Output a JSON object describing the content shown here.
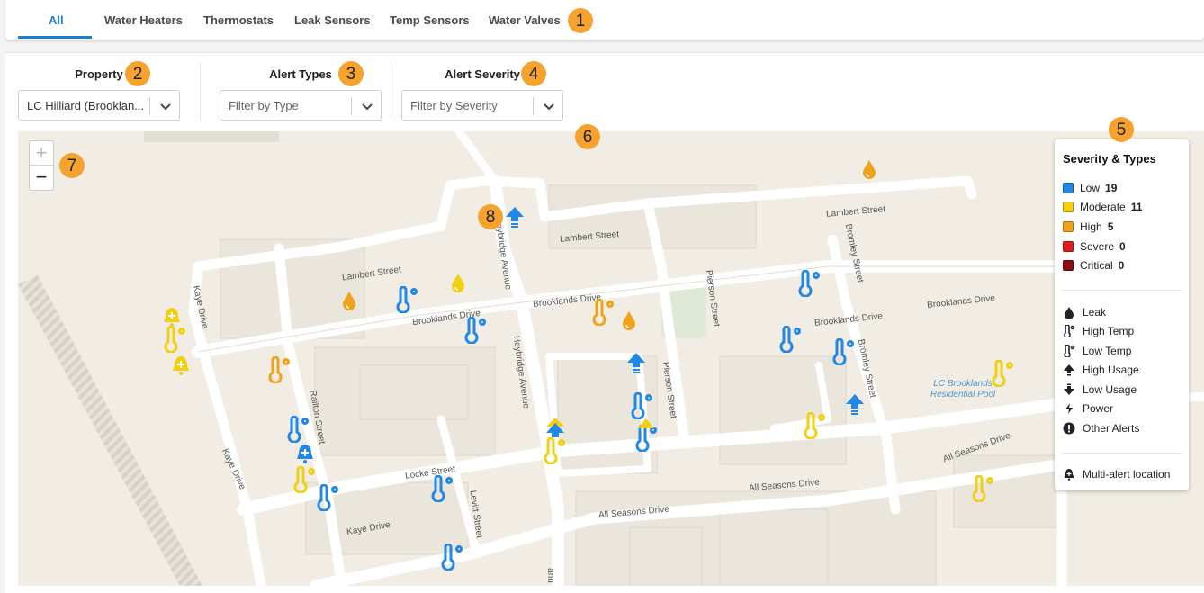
{
  "tabs": [
    {
      "label": "All",
      "active": true
    },
    {
      "label": "Water Heaters"
    },
    {
      "label": "Thermostats"
    },
    {
      "label": "Leak Sensors"
    },
    {
      "label": "Temp Sensors"
    },
    {
      "label": "Water Valves"
    }
  ],
  "filters": {
    "property": {
      "label": "Property",
      "value": "LC Hilliard (Brooklan..."
    },
    "alert_types": {
      "label": "Alert Types",
      "placeholder": "Filter by Type"
    },
    "alert_severity": {
      "label": "Alert Severity",
      "placeholder": "Filter by Severity"
    }
  },
  "badges": [
    "1",
    "2",
    "3",
    "4",
    "5",
    "6",
    "7",
    "8"
  ],
  "zoom": {
    "in": "+",
    "out": "−"
  },
  "map": {
    "streets": {
      "lambert_1": "Lambert Street",
      "lambert_2": "Lambert Street",
      "lambert_3": "Lambert Street",
      "kaye_1": "Kaye Drive",
      "kaye_2": "Kaye Drive",
      "kaye_3": "Kaye Drive",
      "brooklands_1": "Brooklands Drive",
      "brooklands_2": "Brooklands Drive",
      "brooklands_3": "Brooklands Drive",
      "brooklands_4": "Brooklands Drive",
      "heybridge_1": "Heybridge Avenue",
      "heybridge_2": "Heybridge Avenue",
      "heybridge_3": "anu",
      "pierson_1": "Pierson Street",
      "pierson_2": "Pierson Street",
      "bromley_1": "Bromley Street",
      "bromley_2": "Bromley Street",
      "railton": "Railton Street",
      "locke": "Locke Street",
      "levitt": "Levitt Street",
      "allseasons_1": "All Seasons Drive",
      "allseasons_2": "All Seasons Drive",
      "allseasons_3": "All Seasons Drive"
    },
    "pool_label": "LC Brooklands Residential Pool"
  },
  "legend": {
    "title": "Severity & Types",
    "severities": [
      {
        "label": "Low",
        "count": "19",
        "color": "#2188e6"
      },
      {
        "label": "Moderate",
        "count": "11",
        "color": "#f1d012"
      },
      {
        "label": "High",
        "count": "5",
        "color": "#f0a21a"
      },
      {
        "label": "Severe",
        "count": "0",
        "color": "#e21d1d"
      },
      {
        "label": "Critical",
        "count": "0",
        "color": "#8b1010"
      }
    ],
    "types": [
      {
        "label": "Leak",
        "icon": "droplet-icon"
      },
      {
        "label": "High Temp",
        "icon": "thermometer-icon"
      },
      {
        "label": "Low Temp",
        "icon": "thermometer-icon"
      },
      {
        "label": "High Usage",
        "icon": "arrow-up-icon"
      },
      {
        "label": "Low Usage",
        "icon": "arrow-down-icon"
      },
      {
        "label": "Power",
        "icon": "bolt-icon"
      },
      {
        "label": "Other Alerts",
        "icon": "exclamation-icon"
      }
    ],
    "multi_alert": {
      "label": "Multi-alert location",
      "icon": "multi-alert-bell-icon"
    }
  },
  "colors": {
    "accent": "#1b7fcf",
    "badge": "#f5a22f",
    "map_bg": "#f1ede4",
    "road": "#ffffff",
    "green_space": "#dfe9d6"
  }
}
